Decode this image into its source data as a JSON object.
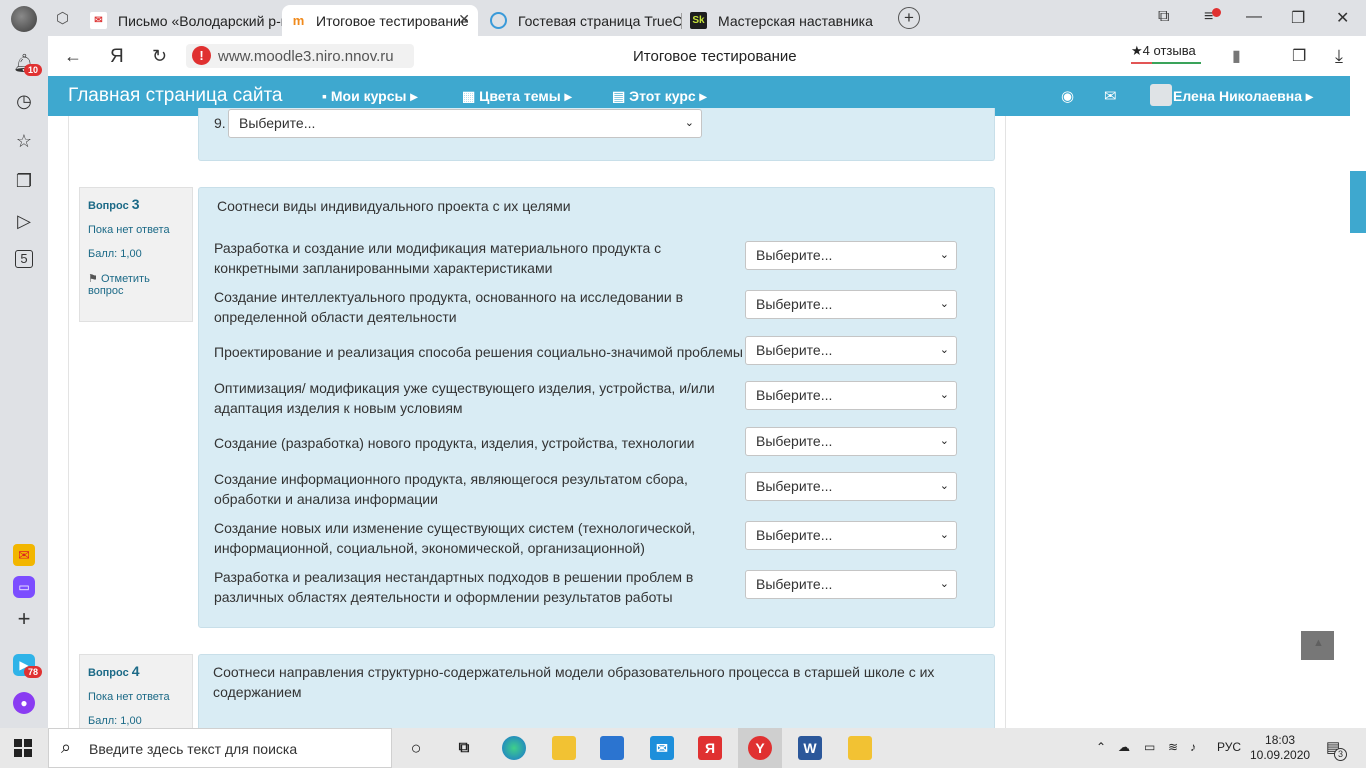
{
  "browser": {
    "tabs": [
      {
        "label": "Письмо «Володарский р-н»"
      },
      {
        "label": "Итоговое тестирование"
      },
      {
        "label": "Гостевая страница TrueConf"
      },
      {
        "label": "Мастерская наставника"
      }
    ],
    "url": "www.moodle3.niro.nnov.ru",
    "page_title": "Итоговое тестирование",
    "reviews": "★4 отзыва",
    "notifications_badge": "10",
    "messenger_badge": "78"
  },
  "navbar": {
    "brand": "Главная страница сайта",
    "my_courses": "Мои курсы",
    "theme_colors": "Цвета темы",
    "this_course": "Этот курс",
    "user": "Елена Николаевна"
  },
  "prev_question": {
    "item_number": "9.",
    "select_value": "Выберите..."
  },
  "question3": {
    "label": "Вопрос",
    "number": "3",
    "status": "Пока нет ответа",
    "score": "Балл: 1,00",
    "flag": "Отметить вопрос",
    "text": "Соотнеси виды индивидуального проекта с их целями",
    "items": [
      {
        "text": "Разработка и создание или модификация материального продукта с конкретными запланированными характеристиками",
        "select": "Выберите..."
      },
      {
        "text": "Создание интеллектуального продукта, основанного на исследовании в определенной области деятельности",
        "select": "Выберите..."
      },
      {
        "text": "Проектирование и реализация способа решения социально-значимой проблемы",
        "select": "Выберите..."
      },
      {
        "text": "Оптимизация/ модификация уже существующего изделия, устройства, и/или адаптация изделия к новым условиям",
        "select": "Выберите..."
      },
      {
        "text": "Создание (разработка) нового продукта, изделия, устройства, технологии",
        "select": "Выберите..."
      },
      {
        "text": "Создание информационного продукта, являющегося результатом сбора, обработки и анализа информации",
        "select": "Выберите..."
      },
      {
        "text": "Создание новых или изменение существующих систем (технологической, информационной, социальной, экономической, организационной)",
        "select": "Выберите..."
      },
      {
        "text": "Разработка и реализация нестандартных подходов  в решении проблем в различных областях деятельности и оформлении результатов работы",
        "select": "Выберите..."
      }
    ]
  },
  "question4": {
    "label": "Вопрос",
    "number": "4",
    "status": "Пока нет ответа",
    "score": "Балл: 1,00",
    "text": "Соотнеси направления структурно-содержательной модели образовательного процесса в старшей школе с их содержанием"
  },
  "taskbar": {
    "search_placeholder": "Введите здесь текст для поиска",
    "lang": "РУС",
    "time": "18:03",
    "date": "10.09.2020",
    "notif_count": "3"
  }
}
